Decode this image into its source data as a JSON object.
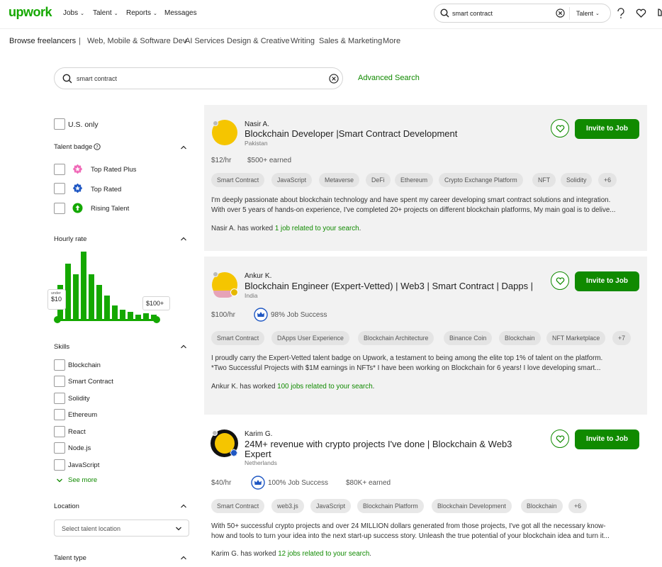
{
  "header": {
    "logo": "upwork",
    "nav": [
      "Jobs",
      "Talent",
      "Reports",
      "Messages"
    ],
    "search_value": "smart contract",
    "search_scope": "Talent"
  },
  "categories": [
    "Browse freelancers",
    "Web, Mobile & Software Dev",
    "AI Services",
    "Design & Creative",
    "Writing",
    "Sales & Marketing",
    "More"
  ],
  "search": {
    "value": "smart contract",
    "advanced": "Advanced Search"
  },
  "filters": {
    "us_only": "U.S. only",
    "talent_badge": {
      "title": "Talent badge",
      "options": [
        "Top Rated Plus",
        "Top Rated",
        "Rising Talent"
      ]
    },
    "hourly_rate": {
      "title": "Hourly rate",
      "min_under": "under",
      "min_label": "$10",
      "max_label": "$100+",
      "histogram": [
        0.49,
        0.8,
        0.64,
        0.97,
        0.64,
        0.49,
        0.34,
        0.19,
        0.13,
        0.1,
        0.06,
        0.08,
        0.06
      ]
    },
    "skills": {
      "title": "Skills",
      "options": [
        "Blockchain",
        "Smart Contract",
        "Solidity",
        "Ethereum",
        "React",
        "Node.js",
        "JavaScript"
      ],
      "see_more": "See more"
    },
    "location": {
      "title": "Location",
      "placeholder": "Select talent location"
    },
    "talent_type": {
      "title": "Talent type"
    }
  },
  "invite_label": "Invite to Job",
  "freelancers": [
    {
      "name": "Nasir A.",
      "title": "Blockchain Developer |Smart Contract Development",
      "country": "Pakistan",
      "rate": "$12/hr",
      "earned": "$500+ earned",
      "skills": [
        "Smart Contract",
        "JavaScript",
        "Metaverse",
        "DeFi",
        "Ethereum",
        "Crypto Exchange Platform",
        "NFT",
        "Solidity",
        "+6"
      ],
      "desc1": "I'm deeply passionate about blockchain technology and have spent my career developing smart contract solutions and integration.",
      "desc2": "With over 5 years of hands-on experience, I've completed 20+ projects on different blockchain platforms, My main goal is to delive...",
      "worked_prefix": "Nasir A. has worked ",
      "worked_link": "1 job related to your search",
      "worked_suffix": "."
    },
    {
      "name": "Ankur K.",
      "title": "Blockchain Engineer (Expert-Vetted) | Web3 | Smart Contract | Dapps |",
      "country": "India",
      "rate": "$100/hr",
      "job_success": "98% Job Success",
      "skills": [
        "Smart Contract",
        "DApps User Experience",
        "Blockchain Architecture",
        "Binance Coin",
        "Blockchain",
        "NFT Marketplace",
        "+7"
      ],
      "desc1": "I proudly carry the Expert-Vetted talent badge on Upwork, a testament to being among the elite top 1% of talent on the platform.",
      "desc2": "*Two Successful Projects with $1M earnings in NFTs* I have been working on Blockchain for 6 years! I love developing smart...",
      "worked_prefix": "Ankur K. has worked ",
      "worked_link": "100 jobs related to your search",
      "worked_suffix": "."
    },
    {
      "name": "Karim G.",
      "title1": "24M+ revenue with crypto projects I've done | Blockchain & Web3",
      "title2": "Expert",
      "country": "Netherlands",
      "rate": "$40/hr",
      "job_success": "100% Job Success",
      "earned": "$80K+ earned",
      "skills": [
        "Smart Contract",
        "web3.js",
        "JavaScript",
        "Blockchain Platform",
        "Blockchain Development",
        "Blockchain",
        "+6"
      ],
      "desc1": "With 50+ successful crypto projects and over 24 MILLION dollars generated from those projects, I've got all the necessary know-",
      "desc2": "how and tools to turn your idea into the next start-up success story. Unleash the true potential of your blockchain idea and turn it...",
      "worked_prefix": "Karim G. has worked ",
      "worked_link": "12 jobs related to your search",
      "worked_suffix": "."
    }
  ]
}
